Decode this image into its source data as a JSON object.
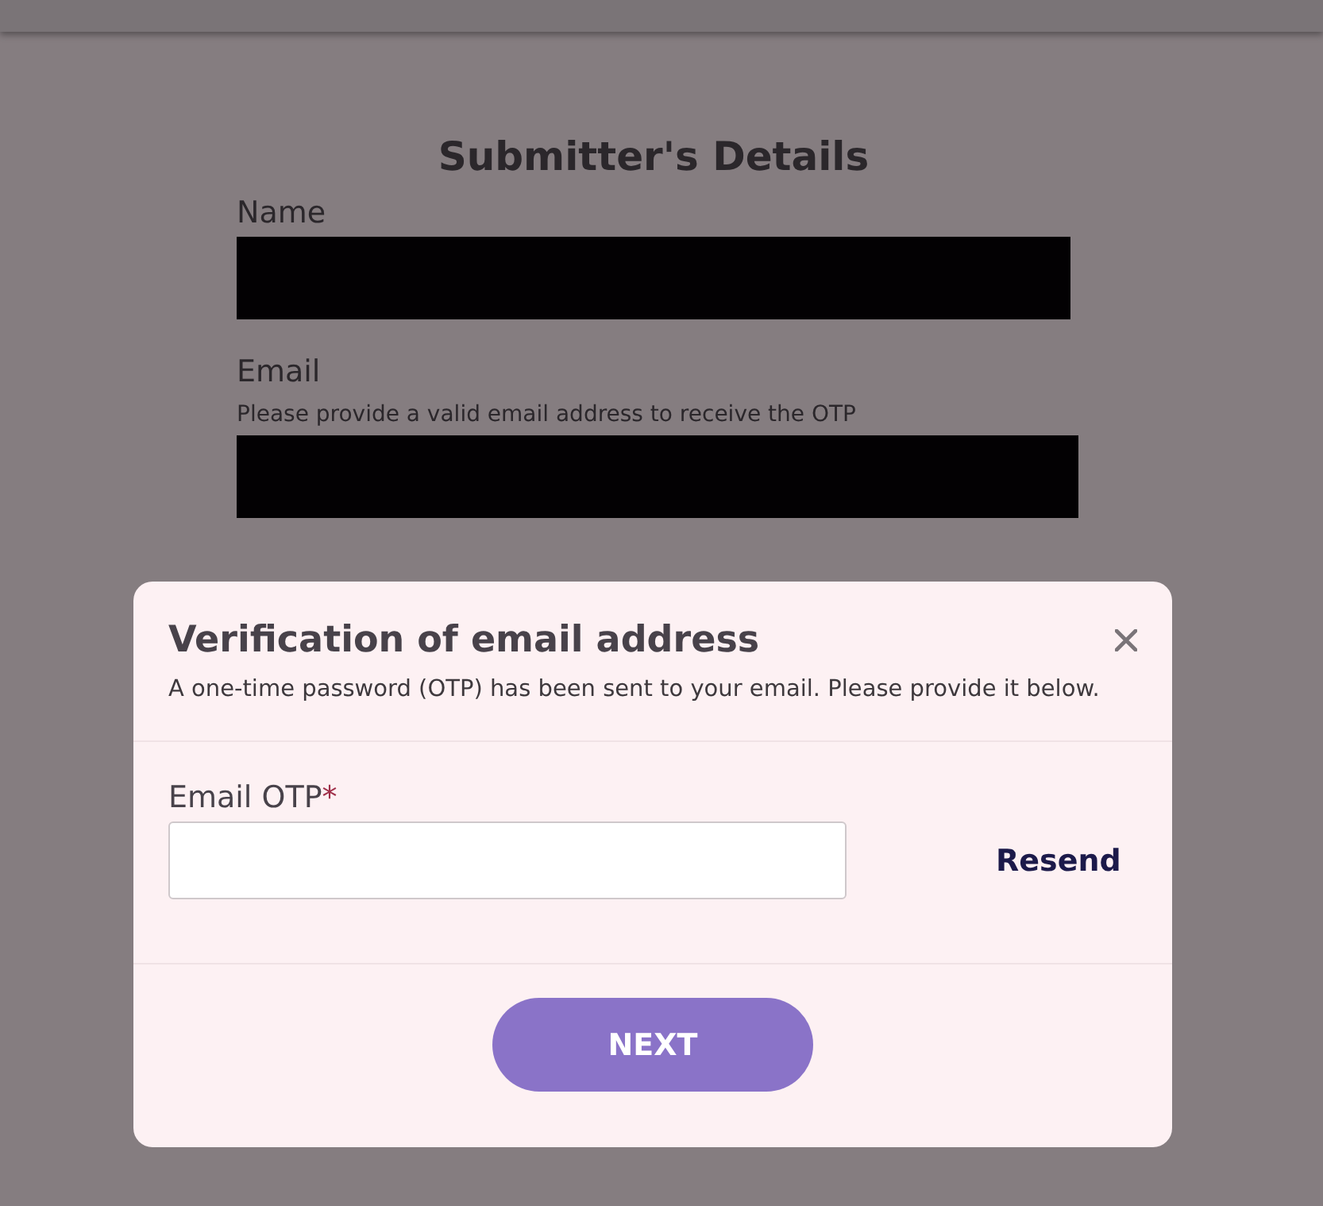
{
  "form": {
    "title": "Submitter's Details",
    "fields": [
      {
        "label": "Name",
        "redacted": true
      },
      {
        "label": "Email",
        "hint": "Please provide a valid email address to receive the OTP",
        "redacted": true
      }
    ]
  },
  "dialog": {
    "title": "Verification of email address",
    "message": "A one-time password (OTP) has been sent to your email. Please provide it below.",
    "field": {
      "label": "Email OTP",
      "required_mark": "*"
    },
    "resend": "Resend",
    "button": "NEXT"
  }
}
